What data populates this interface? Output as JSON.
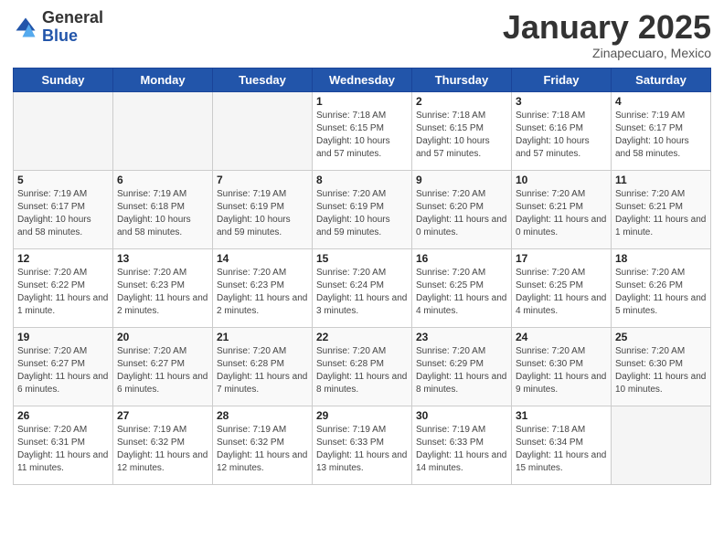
{
  "header": {
    "logo_general": "General",
    "logo_blue": "Blue",
    "month_title": "January 2025",
    "subtitle": "Zinapecuaro, Mexico"
  },
  "weekdays": [
    "Sunday",
    "Monday",
    "Tuesday",
    "Wednesday",
    "Thursday",
    "Friday",
    "Saturday"
  ],
  "weeks": [
    [
      {
        "day": "",
        "info": ""
      },
      {
        "day": "",
        "info": ""
      },
      {
        "day": "",
        "info": ""
      },
      {
        "day": "1",
        "info": "Sunrise: 7:18 AM\nSunset: 6:15 PM\nDaylight: 10 hours and 57 minutes."
      },
      {
        "day": "2",
        "info": "Sunrise: 7:18 AM\nSunset: 6:15 PM\nDaylight: 10 hours and 57 minutes."
      },
      {
        "day": "3",
        "info": "Sunrise: 7:18 AM\nSunset: 6:16 PM\nDaylight: 10 hours and 57 minutes."
      },
      {
        "day": "4",
        "info": "Sunrise: 7:19 AM\nSunset: 6:17 PM\nDaylight: 10 hours and 58 minutes."
      }
    ],
    [
      {
        "day": "5",
        "info": "Sunrise: 7:19 AM\nSunset: 6:17 PM\nDaylight: 10 hours and 58 minutes."
      },
      {
        "day": "6",
        "info": "Sunrise: 7:19 AM\nSunset: 6:18 PM\nDaylight: 10 hours and 58 minutes."
      },
      {
        "day": "7",
        "info": "Sunrise: 7:19 AM\nSunset: 6:19 PM\nDaylight: 10 hours and 59 minutes."
      },
      {
        "day": "8",
        "info": "Sunrise: 7:20 AM\nSunset: 6:19 PM\nDaylight: 10 hours and 59 minutes."
      },
      {
        "day": "9",
        "info": "Sunrise: 7:20 AM\nSunset: 6:20 PM\nDaylight: 11 hours and 0 minutes."
      },
      {
        "day": "10",
        "info": "Sunrise: 7:20 AM\nSunset: 6:21 PM\nDaylight: 11 hours and 0 minutes."
      },
      {
        "day": "11",
        "info": "Sunrise: 7:20 AM\nSunset: 6:21 PM\nDaylight: 11 hours and 1 minute."
      }
    ],
    [
      {
        "day": "12",
        "info": "Sunrise: 7:20 AM\nSunset: 6:22 PM\nDaylight: 11 hours and 1 minute."
      },
      {
        "day": "13",
        "info": "Sunrise: 7:20 AM\nSunset: 6:23 PM\nDaylight: 11 hours and 2 minutes."
      },
      {
        "day": "14",
        "info": "Sunrise: 7:20 AM\nSunset: 6:23 PM\nDaylight: 11 hours and 2 minutes."
      },
      {
        "day": "15",
        "info": "Sunrise: 7:20 AM\nSunset: 6:24 PM\nDaylight: 11 hours and 3 minutes."
      },
      {
        "day": "16",
        "info": "Sunrise: 7:20 AM\nSunset: 6:25 PM\nDaylight: 11 hours and 4 minutes."
      },
      {
        "day": "17",
        "info": "Sunrise: 7:20 AM\nSunset: 6:25 PM\nDaylight: 11 hours and 4 minutes."
      },
      {
        "day": "18",
        "info": "Sunrise: 7:20 AM\nSunset: 6:26 PM\nDaylight: 11 hours and 5 minutes."
      }
    ],
    [
      {
        "day": "19",
        "info": "Sunrise: 7:20 AM\nSunset: 6:27 PM\nDaylight: 11 hours and 6 minutes."
      },
      {
        "day": "20",
        "info": "Sunrise: 7:20 AM\nSunset: 6:27 PM\nDaylight: 11 hours and 6 minutes."
      },
      {
        "day": "21",
        "info": "Sunrise: 7:20 AM\nSunset: 6:28 PM\nDaylight: 11 hours and 7 minutes."
      },
      {
        "day": "22",
        "info": "Sunrise: 7:20 AM\nSunset: 6:28 PM\nDaylight: 11 hours and 8 minutes."
      },
      {
        "day": "23",
        "info": "Sunrise: 7:20 AM\nSunset: 6:29 PM\nDaylight: 11 hours and 8 minutes."
      },
      {
        "day": "24",
        "info": "Sunrise: 7:20 AM\nSunset: 6:30 PM\nDaylight: 11 hours and 9 minutes."
      },
      {
        "day": "25",
        "info": "Sunrise: 7:20 AM\nSunset: 6:30 PM\nDaylight: 11 hours and 10 minutes."
      }
    ],
    [
      {
        "day": "26",
        "info": "Sunrise: 7:20 AM\nSunset: 6:31 PM\nDaylight: 11 hours and 11 minutes."
      },
      {
        "day": "27",
        "info": "Sunrise: 7:19 AM\nSunset: 6:32 PM\nDaylight: 11 hours and 12 minutes."
      },
      {
        "day": "28",
        "info": "Sunrise: 7:19 AM\nSunset: 6:32 PM\nDaylight: 11 hours and 12 minutes."
      },
      {
        "day": "29",
        "info": "Sunrise: 7:19 AM\nSunset: 6:33 PM\nDaylight: 11 hours and 13 minutes."
      },
      {
        "day": "30",
        "info": "Sunrise: 7:19 AM\nSunset: 6:33 PM\nDaylight: 11 hours and 14 minutes."
      },
      {
        "day": "31",
        "info": "Sunrise: 7:18 AM\nSunset: 6:34 PM\nDaylight: 11 hours and 15 minutes."
      },
      {
        "day": "",
        "info": ""
      }
    ]
  ]
}
